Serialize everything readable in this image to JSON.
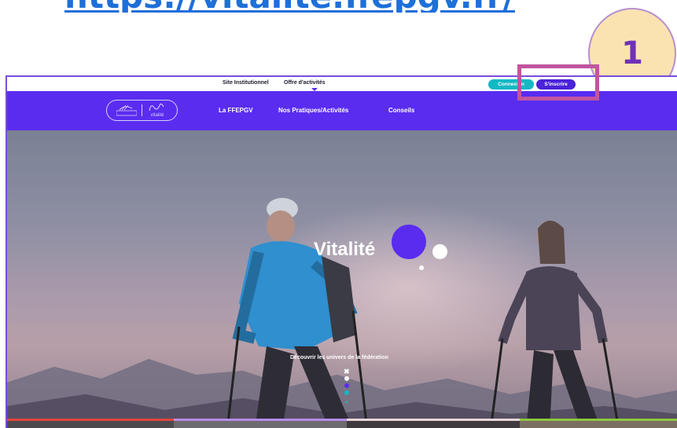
{
  "header_url": "https://vitalite.ffepgv.fr/",
  "step_badge": "1",
  "site": {
    "topbar": {
      "institutional": "Site Institutionnel",
      "offers": "Offre d'activités",
      "login": "Connexion",
      "signup": "S'inscrire"
    },
    "nav": {
      "items": [
        "La FFEPGV",
        "Nos Pratiques/Activités",
        "Conseils"
      ]
    },
    "logo": {
      "right_text": "vitalité"
    },
    "hero": {
      "title": "Vitalité",
      "discover": "Découvrir les univers de la fédération",
      "scroll_x": "✖",
      "scroll_chevron": "⌄"
    },
    "colors": {
      "brand_purple": "#5a2cf0",
      "teal": "#14b8c4",
      "highlight": "#c1559f"
    }
  }
}
